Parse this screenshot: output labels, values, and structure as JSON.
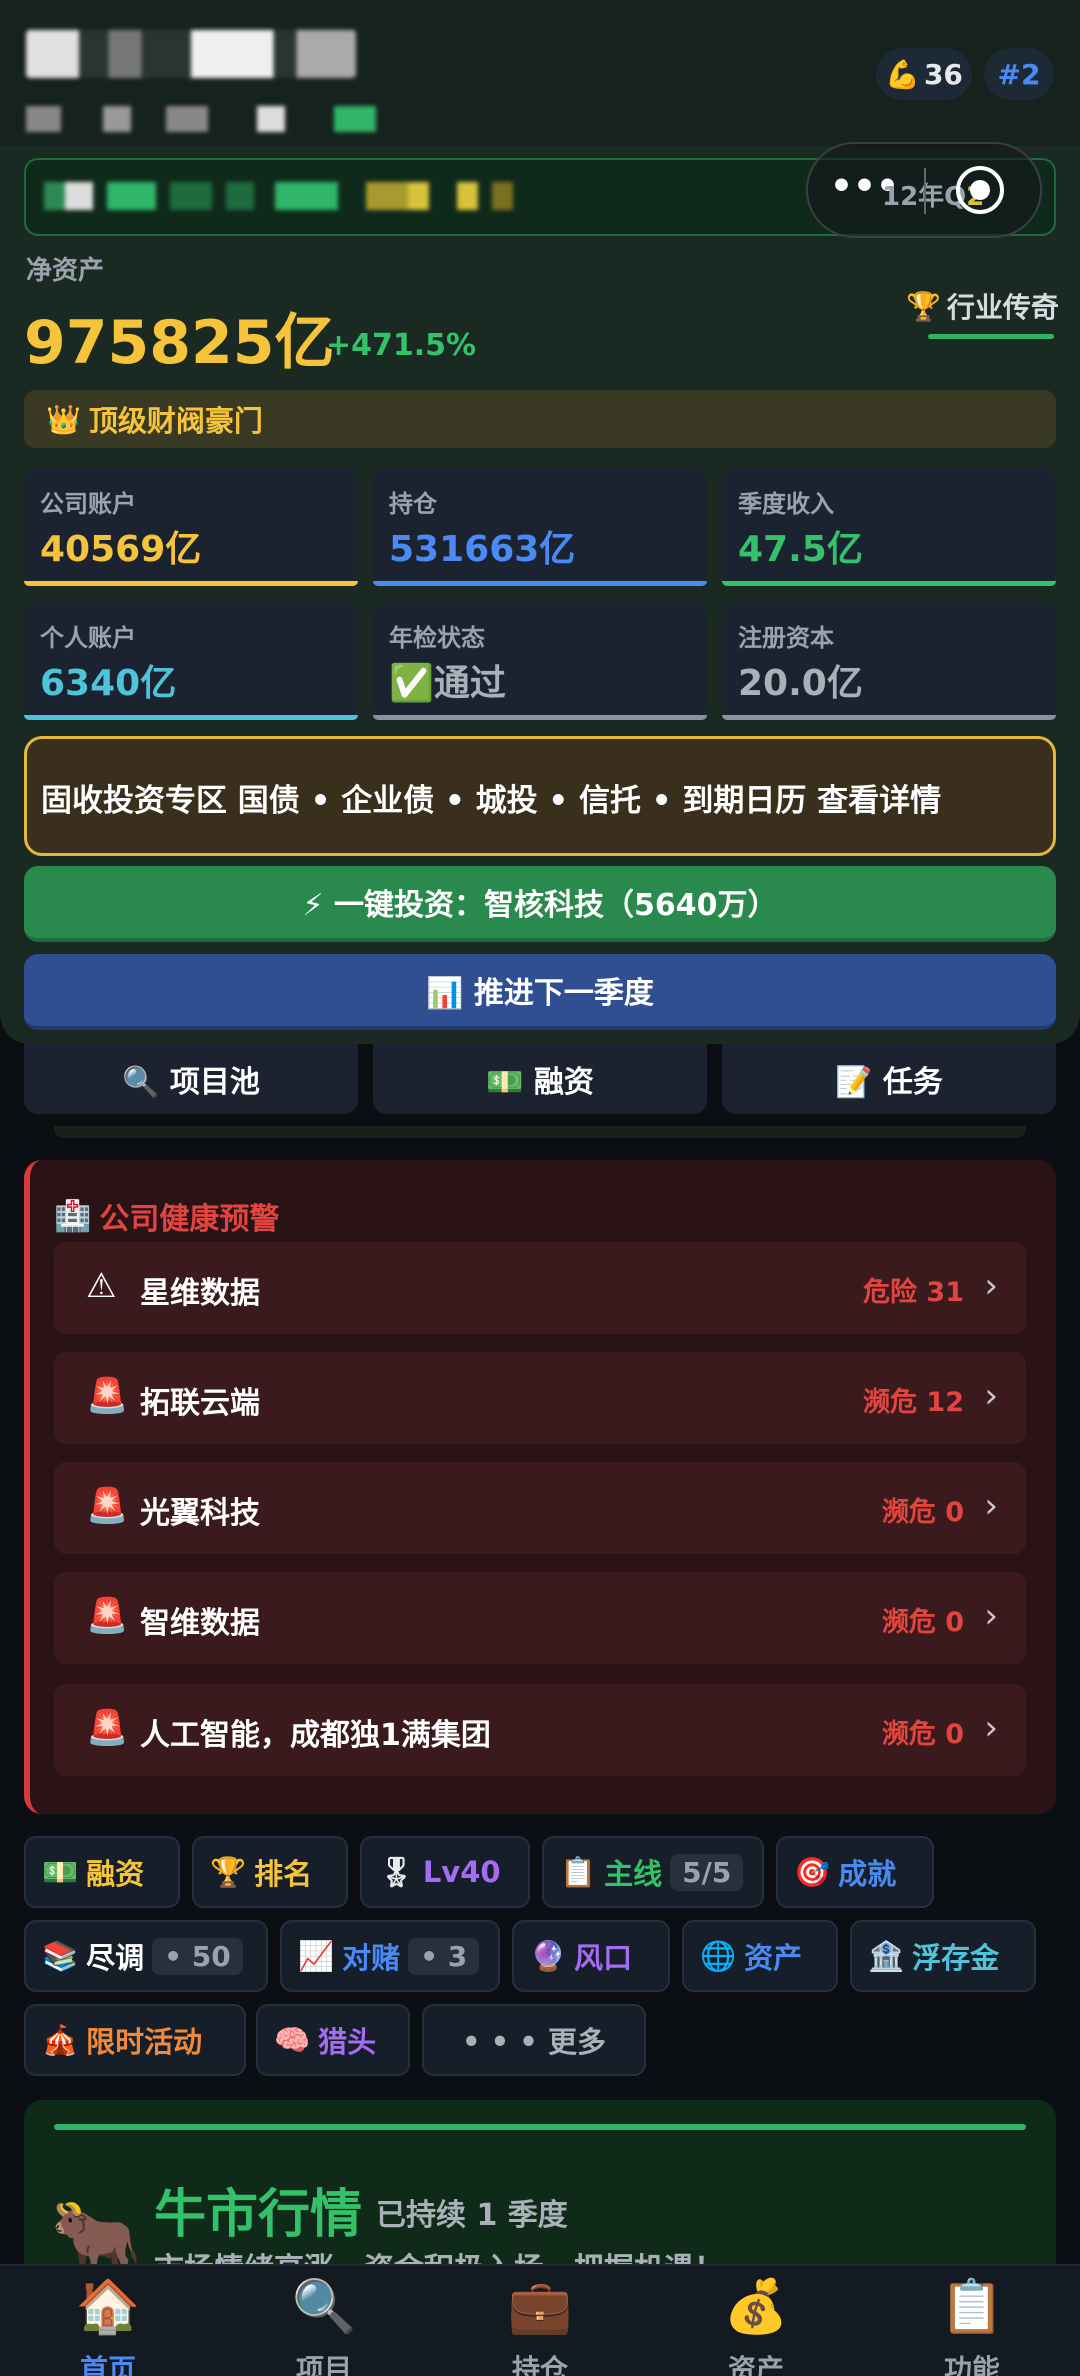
{
  "header": {
    "energy_icon": "flexed-biceps-emoji",
    "energy_value": "36",
    "rank_value": "#2"
  },
  "capsule": {
    "dots": "•••",
    "quarter_text": "12年Q",
    "quarter_suffix": "2"
  },
  "net_assets": {
    "label": "净资产",
    "value": "975825亿",
    "change": "+471.5%",
    "title_badge": "行业传奇",
    "level_banner": "顶级财阀豪门"
  },
  "stats": [
    {
      "label": "公司账户",
      "value": "40569亿",
      "color": "#f5c43a"
    },
    {
      "label": "持仓",
      "value": "531663亿",
      "color": "#4a8af5"
    },
    {
      "label": "季度收入",
      "value": "47.5亿",
      "color": "#33c26a"
    },
    {
      "label": "个人账户",
      "value": "6340亿",
      "color": "#4fc3d8"
    },
    {
      "label": "年检状态",
      "value": "✅通过",
      "color": "#aab0b8"
    },
    {
      "label": "注册资本",
      "value": "20.0亿",
      "color": "#aab0b8"
    }
  ],
  "fixed_income_banner": "固收投资专区  国债  •  企业债  •  城投  •  信托  •  到期日历    查看详情",
  "one_click_invest": "⚡ 一键投资：智核科技（5640万）",
  "next_quarter": "📊 推进下一季度",
  "tabs": [
    "🔍 项目池",
    "💵 融资",
    "📝 任务"
  ],
  "health": {
    "title": "公司健康预警",
    "items": [
      {
        "icon": "⚠",
        "name": "星维数据",
        "status": "危险 31"
      },
      {
        "icon": "🚨",
        "name": "拓联云端",
        "status": "濒危 12"
      },
      {
        "icon": "🚨",
        "name": "光翼科技",
        "status": "濒危 0"
      },
      {
        "icon": "🚨",
        "name": "智维数据",
        "status": "濒危 0"
      },
      {
        "icon": "🚨",
        "name": "人工智能，成都独1满集团",
        "status": "濒危 0"
      }
    ]
  },
  "chips": {
    "financing": "融资",
    "ranking": "排名",
    "level": "Lv40",
    "mainline": "主线",
    "mainline_count": "5/5",
    "achievement": "成就",
    "due_diligence": "尽调",
    "due_diligence_count": "• 50",
    "vam": "对赌",
    "vam_count": "• 3",
    "trend": "风口",
    "assets": "资产",
    "deposit": "浮存金",
    "limited_event": "限时活动",
    "headhunter": "猎头",
    "more": "• • •  更多"
  },
  "market": {
    "title": "牛市行情",
    "duration": "已持续 1 季度",
    "desc": "市场情绪高涨，资金积极入场，把握机遇！"
  },
  "nav": [
    {
      "icon": "🏠",
      "label": "首页"
    },
    {
      "icon": "🔍",
      "label": "项目"
    },
    {
      "icon": "💼",
      "label": "持仓"
    },
    {
      "icon": "💰",
      "label": "资产"
    },
    {
      "icon": "📋",
      "label": "功能"
    }
  ]
}
